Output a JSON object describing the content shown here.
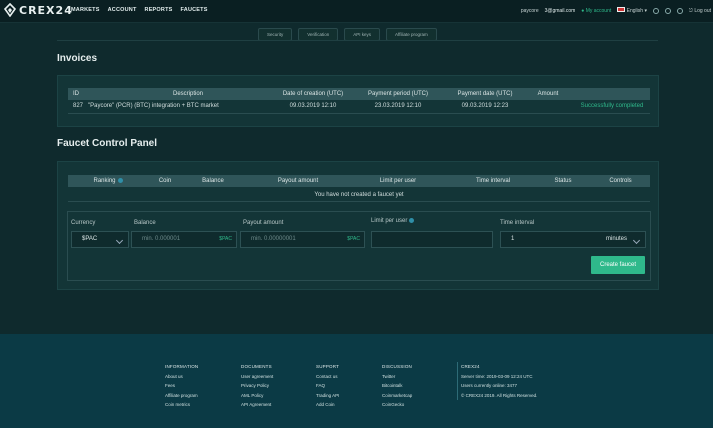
{
  "brand": {
    "name": "CREX24"
  },
  "mainnav": [
    "MARKETS",
    "ACCOUNT",
    "REPORTS",
    "FAUCETS"
  ],
  "rightnav": {
    "user": "paycore",
    "email": "3@gmail.com",
    "account": "My account",
    "language": "English"
  },
  "subtabs": [
    "Security",
    "Verification",
    "API keys",
    "Affiliate program"
  ],
  "invoices": {
    "title": "Invoices",
    "headers": [
      "ID",
      "Description",
      "Date of creation (UTC)",
      "Payment period (UTC)",
      "Payment date (UTC)",
      "Amount"
    ],
    "rows": [
      {
        "id": "827",
        "description": "\"Paycore\" (PCR) (BTC) integration + BTC market",
        "created": "09.03.2019 12:10",
        "period": "23.03.2019 12:10",
        "paid": "09.03.2019 12:23",
        "amount": "",
        "status": "Successfully completed"
      }
    ]
  },
  "faucet": {
    "title": "Faucet Control Panel",
    "headers": [
      "Ranking",
      "Coin",
      "Balance",
      "Payout amount",
      "Limit per user",
      "Time interval",
      "Status",
      "Controls"
    ],
    "empty": "You have not created a faucet yet",
    "form": {
      "currency_label": "Currency",
      "currency_value": "$PAC",
      "balance_label": "Balance",
      "balance_placeholder": "min. 0.000001",
      "balance_unit": "$PAC",
      "payout_label": "Payout amount",
      "payout_placeholder": "min. 0.00000001",
      "payout_unit": "$PAC",
      "limit_label": "Limit per user",
      "interval_label": "Time interval",
      "interval_value": "1",
      "interval_unit": "minutes",
      "create_button": "Create faucet"
    }
  },
  "footer": {
    "cols": [
      {
        "title": "INFORMATION",
        "items": [
          "About us",
          "Fees",
          "Affiliate program",
          "Coin metrics"
        ]
      },
      {
        "title": "DOCUMENTS",
        "items": [
          "User agreement",
          "Privacy Policy",
          "AML Policy",
          "API Agreement"
        ]
      },
      {
        "title": "SUPPORT",
        "items": [
          "Contact us",
          "FAQ",
          "Trading API",
          "Add Coin"
        ]
      },
      {
        "title": "DISCUSSION",
        "items": [
          "Twitter",
          "Bitcointalk",
          "Coinmarketcap",
          "CoinGecko"
        ]
      },
      {
        "title": "CREX24",
        "items": [
          "Server time: 2019-03-09 12:24 UTC",
          "Users currently online: 3477",
          "© CREX24 2019. All Rights Reserved."
        ]
      }
    ]
  }
}
